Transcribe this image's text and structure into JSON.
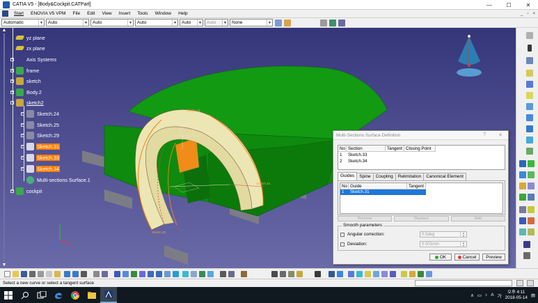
{
  "window": {
    "title": "CATIA V5 - [Body&Cockpit.CATPart]",
    "buttons": [
      "—",
      "☐",
      "✕"
    ]
  },
  "menu": {
    "items": [
      "Start",
      "ENOVIA V5 VPM",
      "File",
      "Edit",
      "View",
      "Insert",
      "Tools",
      "Window",
      "Help"
    ],
    "doc_controls": [
      "_",
      "▫",
      "×"
    ]
  },
  "toolbar": {
    "combos": [
      {
        "value": "Automatic",
        "disabled": false
      },
      {
        "value": "Auto",
        "disabled": false
      },
      {
        "value": "Auto",
        "disabled": false
      },
      {
        "value": "Auto",
        "disabled": false
      },
      {
        "value": "Auto",
        "disabled": false
      },
      {
        "value": "Auto",
        "disabled": true
      },
      {
        "value": "None",
        "disabled": false
      }
    ]
  },
  "tree": {
    "nodes": [
      {
        "label": "yz plane",
        "icon": "plane-icon",
        "state": "normal"
      },
      {
        "label": "zx plane",
        "icon": "plane-icon",
        "state": "normal"
      },
      {
        "label": "Axis Systems",
        "icon": "folder-icon",
        "state": "normal"
      },
      {
        "label": "frame",
        "icon": "body-icon",
        "state": "normal"
      },
      {
        "label": "sketch",
        "icon": "body-icon",
        "state": "normal"
      },
      {
        "label": "Body.2",
        "icon": "body-icon",
        "state": "normal"
      },
      {
        "label": "sketch2",
        "icon": "body-icon",
        "state": "current"
      },
      {
        "label": "Sketch.24",
        "icon": "sketch-icon",
        "state": "normal"
      },
      {
        "label": "Sketch.25",
        "icon": "sketch-icon",
        "state": "normal"
      },
      {
        "label": "Sketch.29",
        "icon": "sketch-icon",
        "state": "normal"
      },
      {
        "label": "Sketch.31",
        "icon": "sketch-icon",
        "state": "selected"
      },
      {
        "label": "Sketch.33",
        "icon": "sketch-icon",
        "state": "selected"
      },
      {
        "label": "Sketch.34",
        "icon": "sketch-icon",
        "state": "selected"
      },
      {
        "label": "Multi-sections Surface.1",
        "icon": "surface-icon",
        "state": "normal"
      },
      {
        "label": "cockpit",
        "icon": "body-icon",
        "state": "normal"
      }
    ]
  },
  "dialog": {
    "title": "Multi-Sections Surface Definition",
    "help": "?",
    "close": "✕",
    "sections": {
      "headers": [
        "No",
        "Section",
        "Tangent",
        "Closing Point"
      ],
      "rows": [
        {
          "no": "1",
          "section": "Sketch.33",
          "tangent": "",
          "closing": ""
        },
        {
          "no": "2",
          "section": "Sketch.34",
          "tangent": "",
          "closing": ""
        }
      ]
    },
    "tabs": [
      "Guides",
      "Spine",
      "Coupling",
      "Relimitation",
      "Canonical Element"
    ],
    "active_tab": "Guides",
    "guides": {
      "headers": [
        "No",
        "Guide",
        "Tangent"
      ],
      "rows": [
        {
          "no": "1",
          "guide": "Sketch.31",
          "tangent": ""
        }
      ]
    },
    "action_buttons": [
      "Remove",
      "Replace",
      "Add"
    ],
    "smooth": {
      "legend": "Smooth parameters",
      "angular_label": "Angular correction:",
      "angular_value": "0.5deg",
      "deviation_label": "Deviation:",
      "deviation_value": "0.001mm"
    },
    "buttons": {
      "ok": "OK",
      "cancel": "Cancel",
      "preview": "Preview"
    }
  },
  "status": {
    "message": "Select a new curve or select a tangent surface"
  },
  "taskbar": {
    "time": "오후 4:11",
    "date": "2018-05-14",
    "ime": "A",
    "lang": "가"
  },
  "colors": {
    "viewport_top": "#35357a",
    "viewport_bottom": "#6a6aa8",
    "model_green": "#0f8f0f",
    "selection": "#ff7e00",
    "surface": "#eae4b0"
  }
}
